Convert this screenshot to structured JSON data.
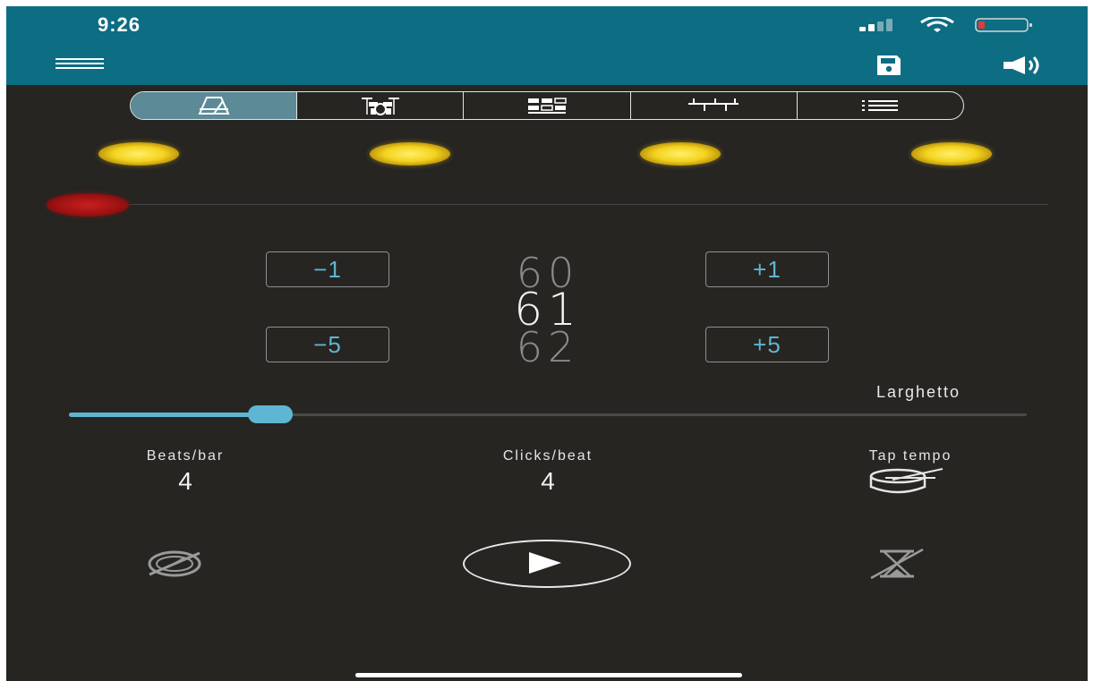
{
  "status_bar": {
    "time": "9:26"
  },
  "header": {
    "icons": [
      "menu-icon",
      "save-icon",
      "volume-icon"
    ]
  },
  "tabs": [
    {
      "icon": "metronome-icon",
      "active": true
    },
    {
      "icon": "drum-kit-icon",
      "active": false
    },
    {
      "icon": "grid-pattern-icon",
      "active": false
    },
    {
      "icon": "mixer-icon",
      "active": false
    },
    {
      "icon": "list-icon",
      "active": false
    }
  ],
  "beat_lights": {
    "count": 4,
    "color": "#f4d21e"
  },
  "downbeat_light": {
    "color": "#9e1212"
  },
  "tempo": {
    "minus1_label": "−1",
    "plus1_label": "+1",
    "minus5_label": "−5",
    "plus5_label": "+5",
    "previous": "60",
    "current": "61",
    "next": "62",
    "name": "Larghetto",
    "slider_fraction": 0.21
  },
  "settings": {
    "beats_per_bar_label": "Beats/bar",
    "beats_per_bar_value": "4",
    "clicks_per_beat_label": "Clicks/beat",
    "clicks_per_beat_value": "4",
    "tap_tempo_label": "Tap tempo"
  },
  "bottom_controls": {
    "icons": [
      "speed-trainer-icon",
      "play-icon",
      "timer-off-icon"
    ]
  },
  "colors": {
    "header": "#0c6d83",
    "background": "#262522",
    "accent": "#5fb6d2",
    "active_tab": "#5c8b97"
  }
}
